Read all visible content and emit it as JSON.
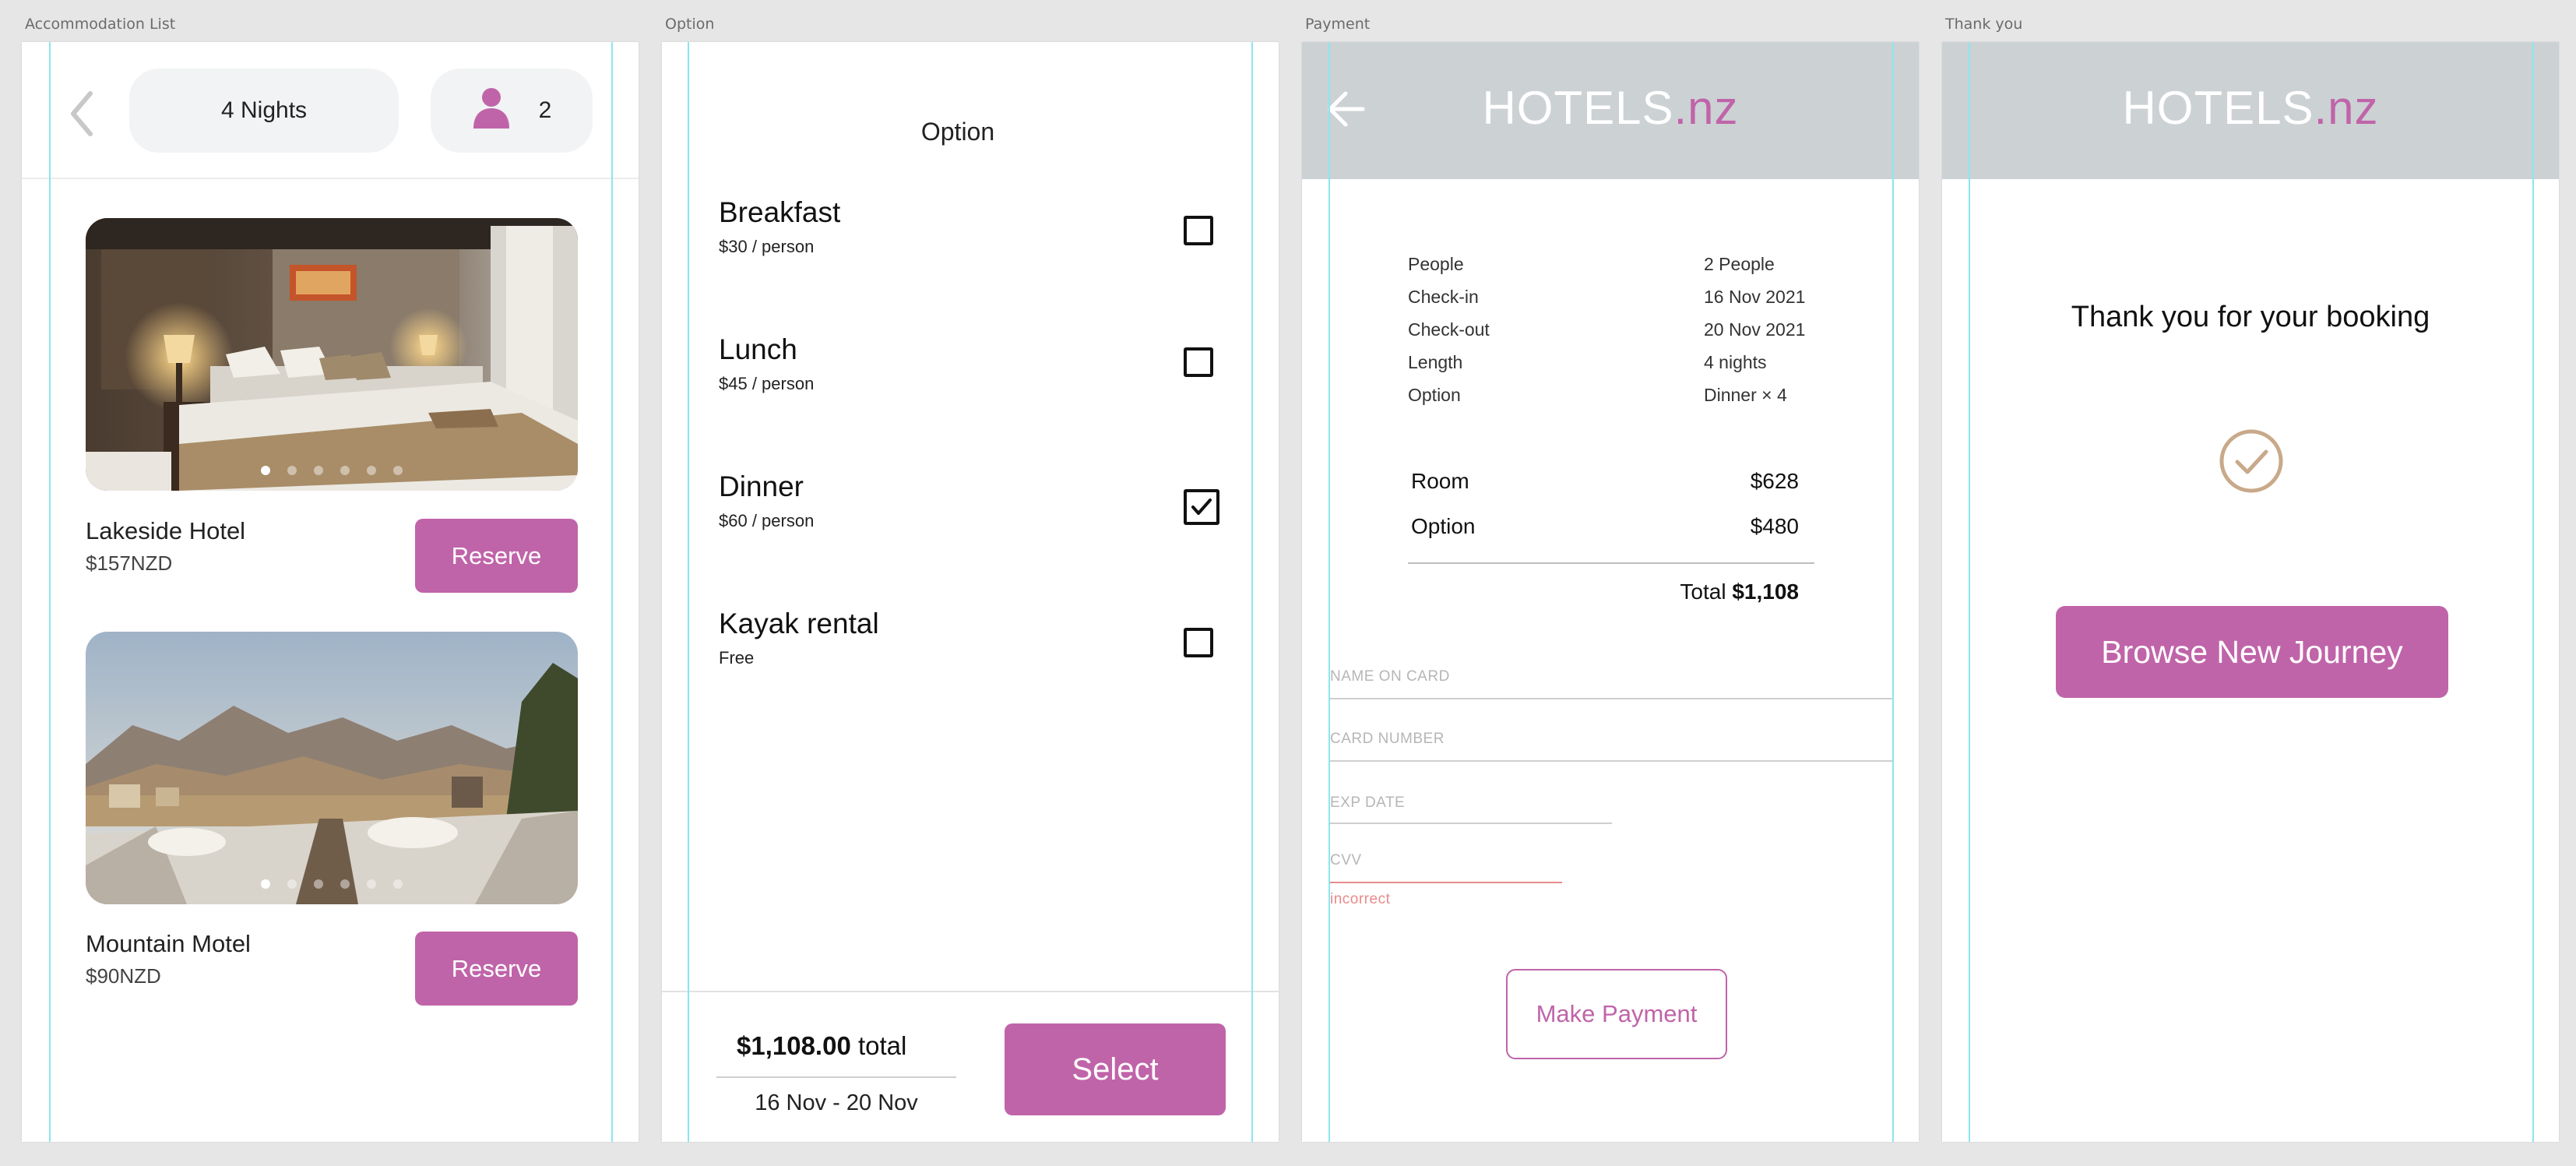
{
  "artboards": {
    "list": "Accommodation List",
    "option": "Option",
    "payment": "Payment",
    "thankyou": "Thank you"
  },
  "list_screen": {
    "nights": "4 Nights",
    "guests": "2",
    "photo_count": 6,
    "hotels": [
      {
        "name": "Lakeside Hotel",
        "price": "$157NZD",
        "reserve_label": "Reserve",
        "active_photo": 1
      },
      {
        "name": "Mountain Motel",
        "price": "$90NZD",
        "reserve_label": "Reserve",
        "active_photo": 1
      }
    ]
  },
  "option_screen": {
    "title": "Option",
    "options": [
      {
        "name": "Breakfast",
        "price": "$30 / person",
        "checked": false
      },
      {
        "name": "Lunch",
        "price": "$45 / person",
        "checked": false
      },
      {
        "name": "Dinner",
        "price": "$60 / person",
        "checked": true
      },
      {
        "name": "Kayak rental",
        "price": "Free",
        "checked": false
      }
    ],
    "total_amount": "$1,108.00",
    "total_word": "total",
    "dates": "16 Nov - 20 Nov",
    "select_label": "Select"
  },
  "brand": {
    "name": "HOTELS",
    "suffix": ".nz"
  },
  "payment_screen": {
    "summary": [
      {
        "label": "People",
        "value": "2 People"
      },
      {
        "label": "Check-in",
        "value": "16 Nov 2021"
      },
      {
        "label": "Check-out",
        "value": "20 Nov 2021"
      },
      {
        "label": "Length",
        "value": "4 nights"
      },
      {
        "label": "Option",
        "value": "Dinner × 4"
      }
    ],
    "room_label": "Room",
    "room_price": "$628",
    "option_label": "Option",
    "option_price": "$480",
    "total_label": "Total",
    "total_value": "$1,108",
    "name_placeholder": "NAME ON CARD",
    "card_placeholder": "CARD NUMBER",
    "exp_placeholder": "EXP DATE",
    "cvv_placeholder": "CVV",
    "cvv_error": "incorrect",
    "pay_label": "Make Payment"
  },
  "thanks_screen": {
    "message": "Thank you for your booking",
    "browse_label": "Browse New Journey"
  },
  "colors": {
    "accent": "#c064a9",
    "header_bg": "#ccd1d4",
    "error": "#e88a8a",
    "check_gold": "#c8a98a"
  }
}
